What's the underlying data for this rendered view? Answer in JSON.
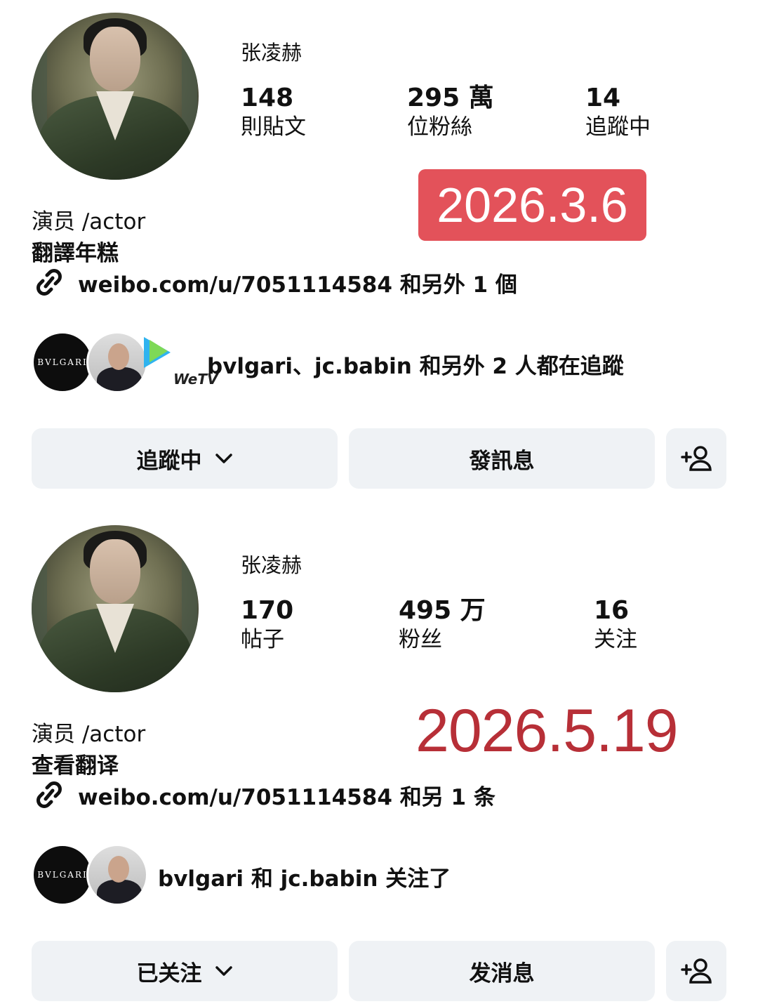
{
  "profiles": [
    {
      "name": "张凌赫",
      "stats": [
        {
          "value": "148",
          "label": "則貼文"
        },
        {
          "value": "295 萬",
          "label": "位粉絲"
        },
        {
          "value": "14",
          "label": "追蹤中"
        }
      ],
      "bio_line1": "演员 /actor",
      "bio_line2": "翻譯年糕",
      "link": "weibo.com/u/7051114584 和另外 1 個",
      "date_label": "2026.3.6",
      "followed_by": {
        "avatars": [
          "BVLGARI",
          "jc.babin",
          "WeTV"
        ],
        "text": "bvlgari、jc.babin 和另外 2 人都在追蹤"
      },
      "buttons": {
        "follow": "追蹤中",
        "message": "發訊息",
        "add_person_icon": "add-person-icon"
      }
    },
    {
      "name": "张凌赫",
      "stats": [
        {
          "value": "170",
          "label": "帖子"
        },
        {
          "value": "495 万",
          "label": "粉丝"
        },
        {
          "value": "16",
          "label": "关注"
        }
      ],
      "bio_line1": "演员 /actor",
      "bio_line2": "查看翻译",
      "link": "weibo.com/u/7051114584 和另 1 条",
      "date_label": "2026.5.19",
      "followed_by": {
        "avatars": [
          "BVLGARI",
          "jc.babin"
        ],
        "text": "bvlgari 和 jc.babin 关注了"
      },
      "buttons": {
        "follow": "已关注",
        "message": "发消息",
        "add_person_icon": "add-person-icon"
      }
    }
  ],
  "colors": {
    "badge_bg": "#e3525a",
    "date_text": "#b72f37",
    "button_bg": "#eff2f5"
  }
}
